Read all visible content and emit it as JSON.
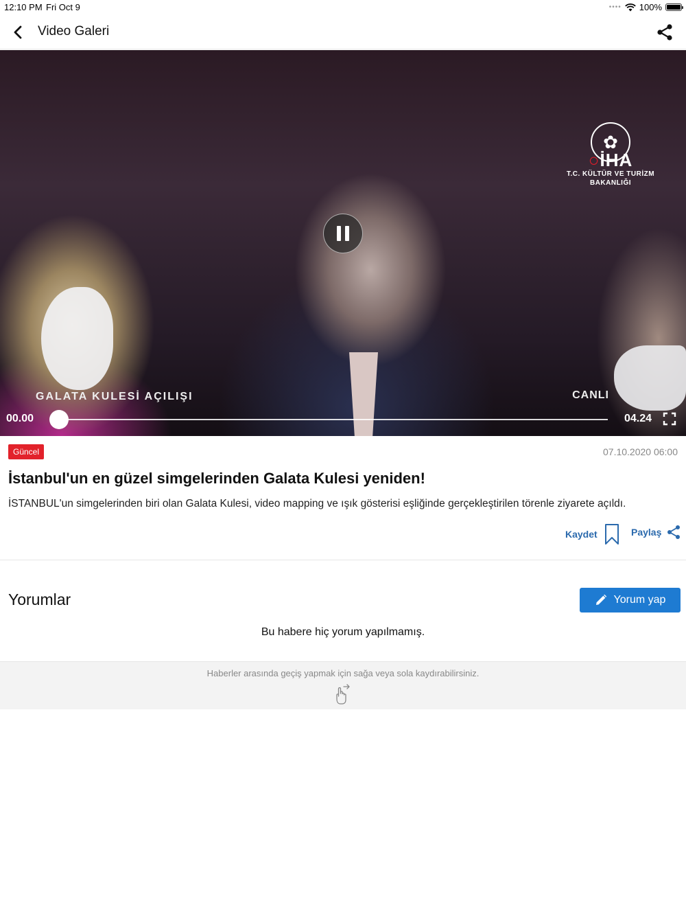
{
  "status_bar": {
    "time": "12:10 PM",
    "date": "Fri Oct 9",
    "battery": "100%"
  },
  "nav": {
    "title": "Video Galeri",
    "back_icon": "chevron-left-icon",
    "share_icon": "share-icon"
  },
  "video": {
    "watermark": {
      "brand": "İHA",
      "ministry_line1": "T.C. KÜLTÜR VE TURİZM",
      "ministry_line2": "BAKANLIĞI"
    },
    "caption_left": "GALATA KULESİ AÇILIŞI",
    "caption_right": "CANLI",
    "current_time": "00.00",
    "total_time": "04.24",
    "progress": 0,
    "state": "playing"
  },
  "article": {
    "category": "Güncel",
    "date": "07.10.2020 06:00",
    "title": "İstanbul'un en güzel simgelerinden Galata Kulesi yeniden!",
    "summary": "İSTANBUL'un simgelerinden biri olan Galata Kulesi, video mapping ve ışık gösterisi eşliğinde gerçekleştirilen törenle ziyarete açıldı.",
    "save_label": "Kaydet",
    "share_label": "Paylaş"
  },
  "comments": {
    "title": "Yorumlar",
    "button_label": "Yorum yap",
    "empty_text": "Bu habere hiç yorum yapılmamış."
  },
  "swipe_hint": {
    "text": "Haberler arasında geçiş yapmak için sağa veya sola kaydırabilirsiniz."
  },
  "colors": {
    "accent": "#1e7bd2",
    "link": "#2b6aad",
    "badge": "#e2222b"
  }
}
